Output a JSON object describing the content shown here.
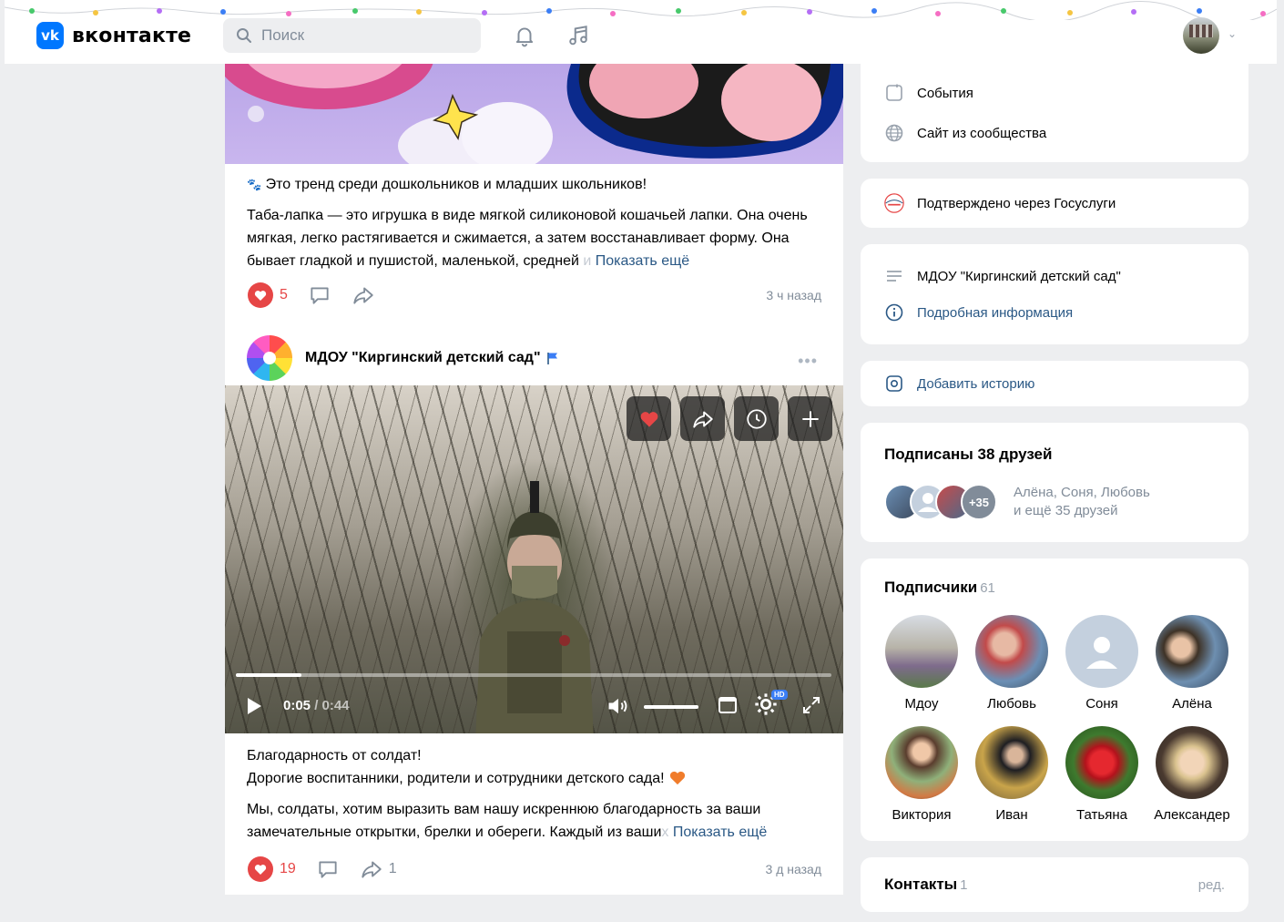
{
  "header": {
    "logo_text": "вконтакте",
    "logo_mark": "vk",
    "search_placeholder": "Поиск",
    "icons": [
      "search-icon",
      "bell-icon",
      "music-icon",
      "chevron-down-icon"
    ]
  },
  "feed": {
    "post1": {
      "title_line": "Это тренд среди дошкольников и младших школьников!",
      "body": "Таба-лапка — это игрушка в виде мягкой силиконовой кошачьей лапки. Она очень мягкая, легко растягивается и сжимается, а затем восстанавливает форму. Она бывает гладкой и пушистой, маленькой, средней",
      "body_fade": " и",
      "more": "Показать ещё",
      "likes": "5",
      "time": "3 ч назад"
    },
    "post2": {
      "group_name": "МДОУ \"Киргинский детский сад\"",
      "video": {
        "current": "0:05",
        "duration": "0:44",
        "progress_pct": 11,
        "volume_pct": 100,
        "hd_badge": "HD"
      },
      "line1": "Благодарность от солдат!",
      "line2": "Дорогие воспитанники, родители и сотрудники детского сада!",
      "body": "Мы, солдаты, хотим выразить вам нашу искреннюю благодарность за ваши замечательные открытки, брелки и обереги. Каждый из ваши",
      "body_fade": "х",
      "more": "Показать ещё",
      "likes": "19",
      "shares": "1",
      "time": "3 д назад"
    }
  },
  "side": {
    "menu1": [
      "События",
      "Сайт из сообщества"
    ],
    "gosuslugi": "Подтверждено через Госуслуги",
    "group_title": "МДОУ \"Киргинский детский сад\"",
    "info_link": "Подробная информация",
    "add_story": "Добавить историю",
    "friends_title": "Подписаны 38 друзей",
    "friends_more": "+35",
    "friends_names": "Алёна, Соня, Любовь",
    "friends_rest": "и ещё 35 друзей",
    "subs_title": "Подписчики",
    "subs_count": "61",
    "subscribers": [
      "Мдоу",
      "Любовь",
      "Соня",
      "Алёна",
      "Виктория",
      "Иван",
      "Татьяна",
      "Александер"
    ],
    "contacts_title": "Контакты",
    "contacts_count": "1",
    "contacts_edit": "ред."
  },
  "colors": {
    "accent": "#0077ff",
    "link": "#2a5885",
    "like": "#e64646",
    "page_bg": "#edeef0"
  }
}
